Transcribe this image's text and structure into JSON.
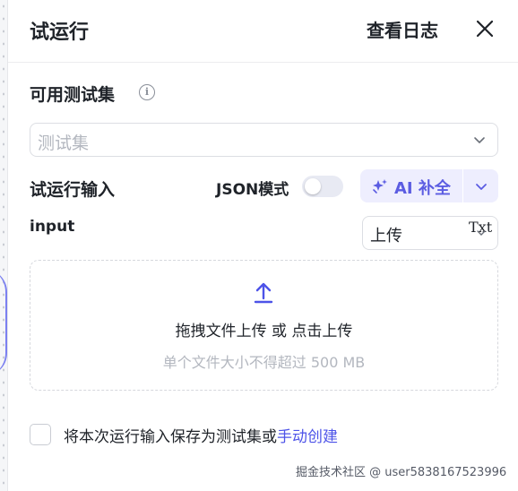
{
  "header": {
    "title": "试运行",
    "view_log": "查看日志"
  },
  "test_set": {
    "label": "可用测试集",
    "placeholder": "测试集"
  },
  "run_input": {
    "label": "试运行输入",
    "json_mode_label": "JSON模式",
    "json_mode_on": false,
    "ai_fill_label": "AI 补全"
  },
  "input_field": {
    "name": "input",
    "upload_value": "上传",
    "type_tag": "Txt"
  },
  "dropzone": {
    "drag_text": "拖拽文件上传",
    "or_text": " 或 ",
    "click_text": "点击上传",
    "limit_text": "单个文件大小不得超过 500 MB"
  },
  "save": {
    "text": "将本次运行输入保存为测试集或",
    "link": "手动创建"
  },
  "watermark": "掘金技术社区 @ user5838167523996",
  "colors": {
    "accent": "#4d53e8",
    "ai_bg": "#eeeefe",
    "placeholder": "#b3b7bf"
  }
}
